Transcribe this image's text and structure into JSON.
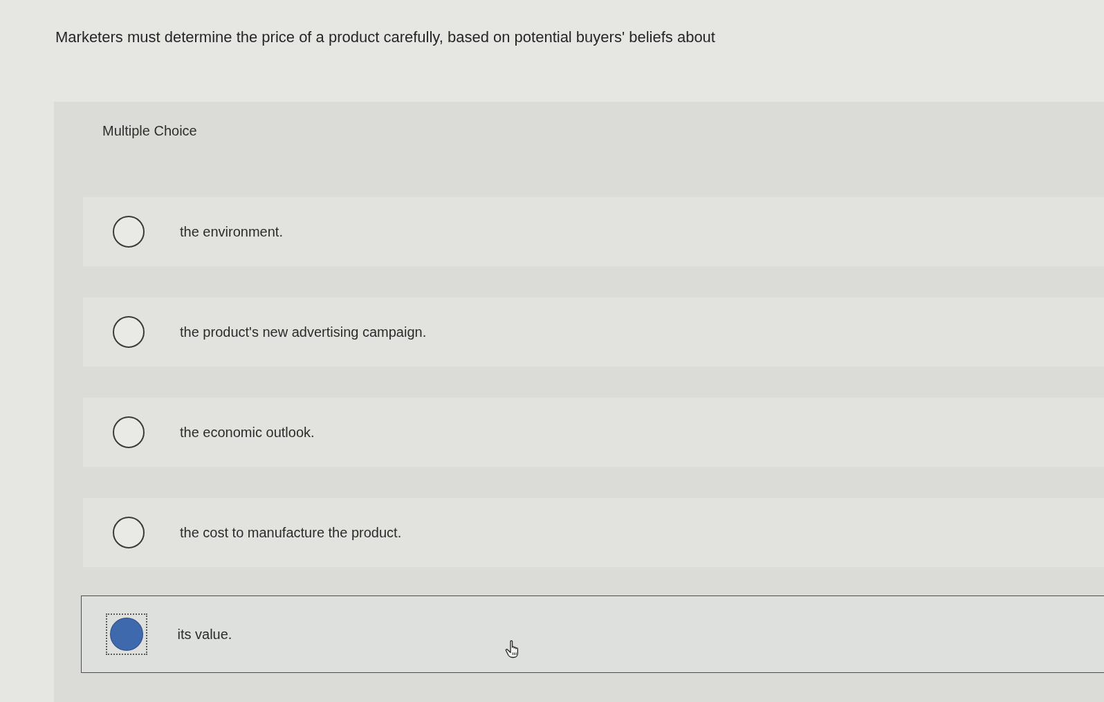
{
  "question": {
    "text": "Marketers must determine the price of a product carefully, based on potential buyers' beliefs about"
  },
  "answer_panel": {
    "label": "Multiple Choice",
    "options": [
      {
        "text": "the environment.",
        "selected": false
      },
      {
        "text": "the product's new advertising campaign.",
        "selected": false
      },
      {
        "text": "the economic outlook.",
        "selected": false
      },
      {
        "text": "the cost to manufacture the product.",
        "selected": false
      },
      {
        "text": "its value.",
        "selected": true
      }
    ]
  }
}
